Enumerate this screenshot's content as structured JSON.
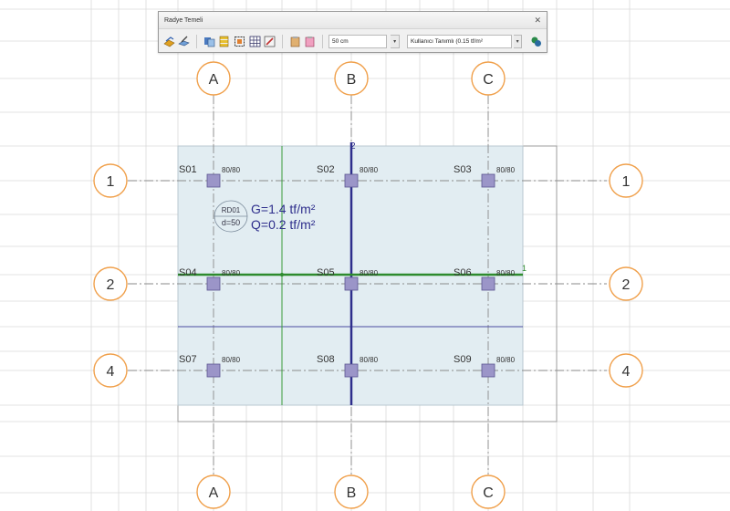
{
  "toolbar": {
    "title": "Radye Temeli",
    "close_glyph": "✕",
    "thickness_value": "50 cm",
    "load_value": "Kullanıcı Tanımlı (0.15 tf/m²",
    "icons": [
      "raft-icon",
      "raft-edit-icon",
      "copy-icon",
      "stack-icon",
      "select-icon",
      "grid-icon",
      "paint-icon",
      "paste-icon",
      "paste-special-icon",
      "settings-icon"
    ]
  },
  "axes": {
    "columns": [
      "A",
      "B",
      "C"
    ],
    "rows": [
      "1",
      "2",
      "4"
    ]
  },
  "columns": [
    {
      "id": "S01",
      "size": "80/80"
    },
    {
      "id": "S02",
      "size": "80/80"
    },
    {
      "id": "S03",
      "size": "80/80"
    },
    {
      "id": "S04",
      "size": "80/80"
    },
    {
      "id": "S05",
      "size": "80/80"
    },
    {
      "id": "S06",
      "size": "80/80"
    },
    {
      "id": "S07",
      "size": "80/80"
    },
    {
      "id": "S08",
      "size": "80/80"
    },
    {
      "id": "S09",
      "size": "80/80"
    }
  ],
  "raft": {
    "name": "RD01",
    "thickness": "d=50",
    "load_g": "G=1.4 tf/m²",
    "load_q": "Q=0.2 tf/m²"
  },
  "beam_labels": {
    "vertical": "2",
    "horizontal": "1"
  },
  "colors": {
    "grid": "#d8d8d8",
    "slab_fill": "#e2edf2",
    "axis_bubble": "#f0a04b",
    "column_fill": "#9b95c8",
    "beam_blue": "#2e2e8c",
    "beam_green": "#2e8b2e"
  }
}
